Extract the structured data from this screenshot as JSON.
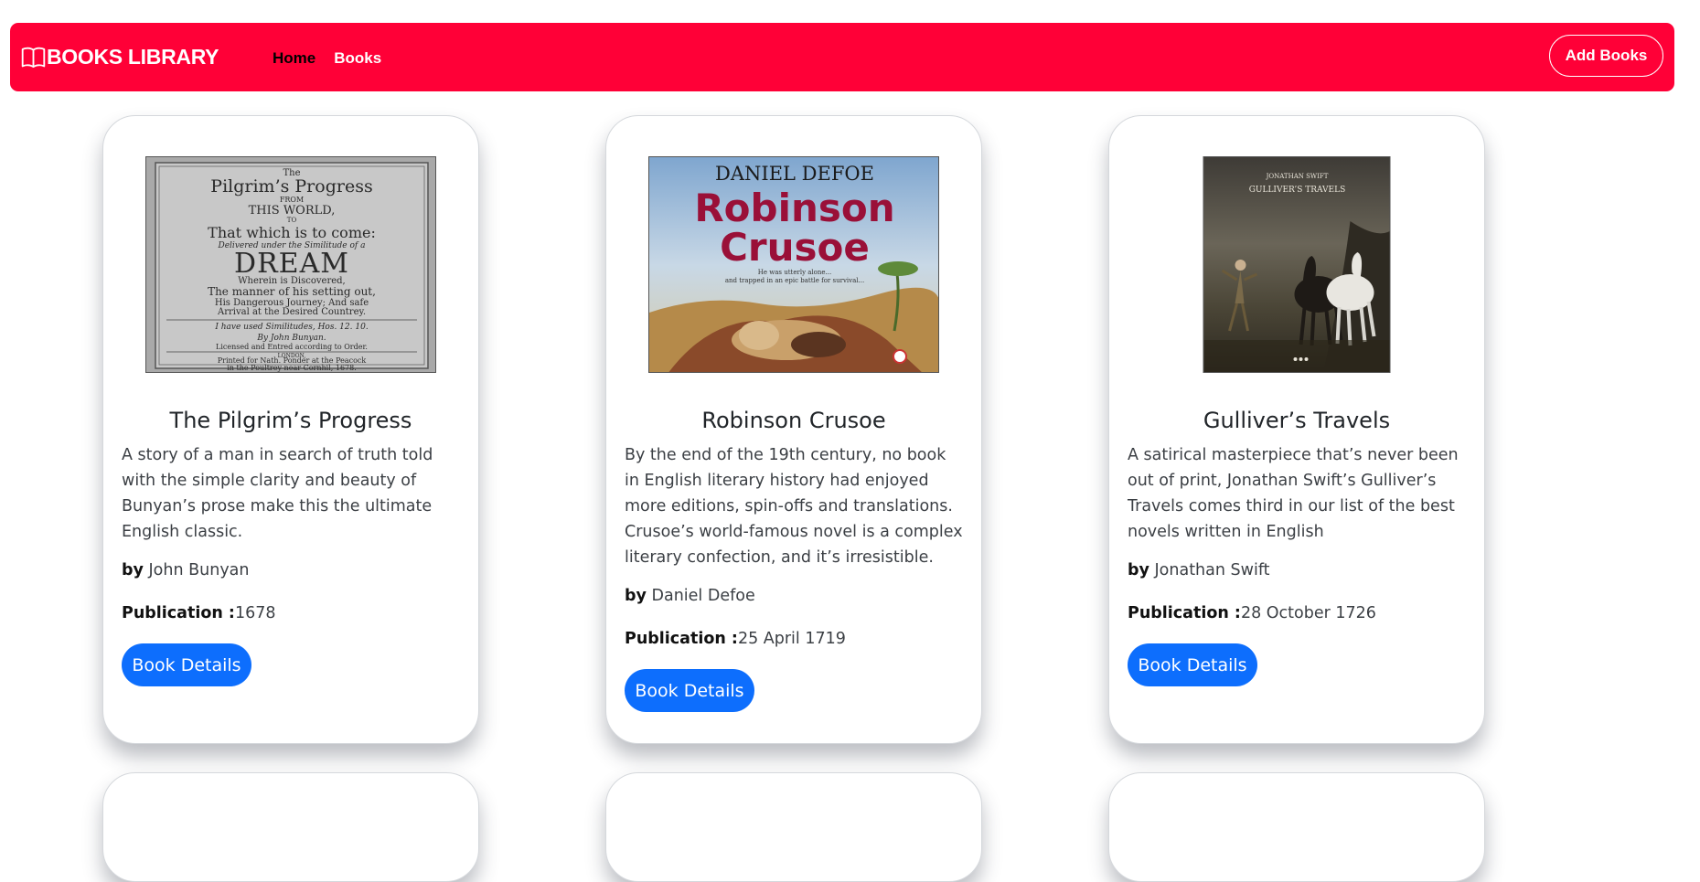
{
  "nav": {
    "brand": "BOOKS LIBRARY",
    "brand_icon": "open-book-icon",
    "links": [
      "Home",
      "Books"
    ],
    "add_button": "Add Books",
    "color": "#ff0037"
  },
  "books": [
    {
      "title": "The Pilgrim’s Progress",
      "description": "A story of a man in search of truth told with the simple clarity and beauty of Bunyan’s prose make this the ultimate English classic.",
      "by_label": "by",
      "author": "John Bunyan",
      "publication_label": "Publication :",
      "publication": "1678",
      "button": "Book Details",
      "cover_text": [
        "The",
        "Pilgrim’s Progress",
        "FROM",
        "THIS WORLD,",
        "TO",
        "That which is to come:",
        "Delivered under the Similitude of a",
        "DREAM",
        "Wherein is Discovered,",
        "The manner of his setting out,",
        "His Dangerous Journey; And safe",
        "Arrival at the Desired Countrey.",
        "I have used Similitudes, Hos. 12. 10.",
        "By John Bunyan.",
        "Licensed and Entred according to Order.",
        "LONDON,",
        "Printed for Nath. Ponder at the Peacock",
        "in the Poultrey near Cornhil, 1678."
      ]
    },
    {
      "title": "Robinson Crusoe",
      "description": "By the end of the 19th century, no book in English literary history had enjoyed more editions, spin-offs and translations. Crusoe’s world-famous novel is a complex literary confection, and it’s irresistible.",
      "by_label": "by",
      "author": "Daniel Defoe",
      "publication_label": "Publication :",
      "publication": "25 April 1719",
      "button": "Book Details",
      "cover_text": [
        "DANIEL DEFOE",
        "Robinson",
        "Crusoe",
        "He was utterly alone...",
        "and trapped in an epic battle for survival..."
      ]
    },
    {
      "title": "Gulliver’s Travels",
      "description": "A satirical masterpiece that’s never been out of print, Jonathan Swift’s Gulliver’s Travels comes third in our list of the best novels written in English",
      "by_label": "by",
      "author": "Jonathan Swift",
      "publication_label": "Publication :",
      "publication": "28 October 1726",
      "button": "Book Details",
      "cover_text": [
        "JONATHAN SWIFT",
        "GULLIVER’S TRAVELS"
      ]
    }
  ]
}
